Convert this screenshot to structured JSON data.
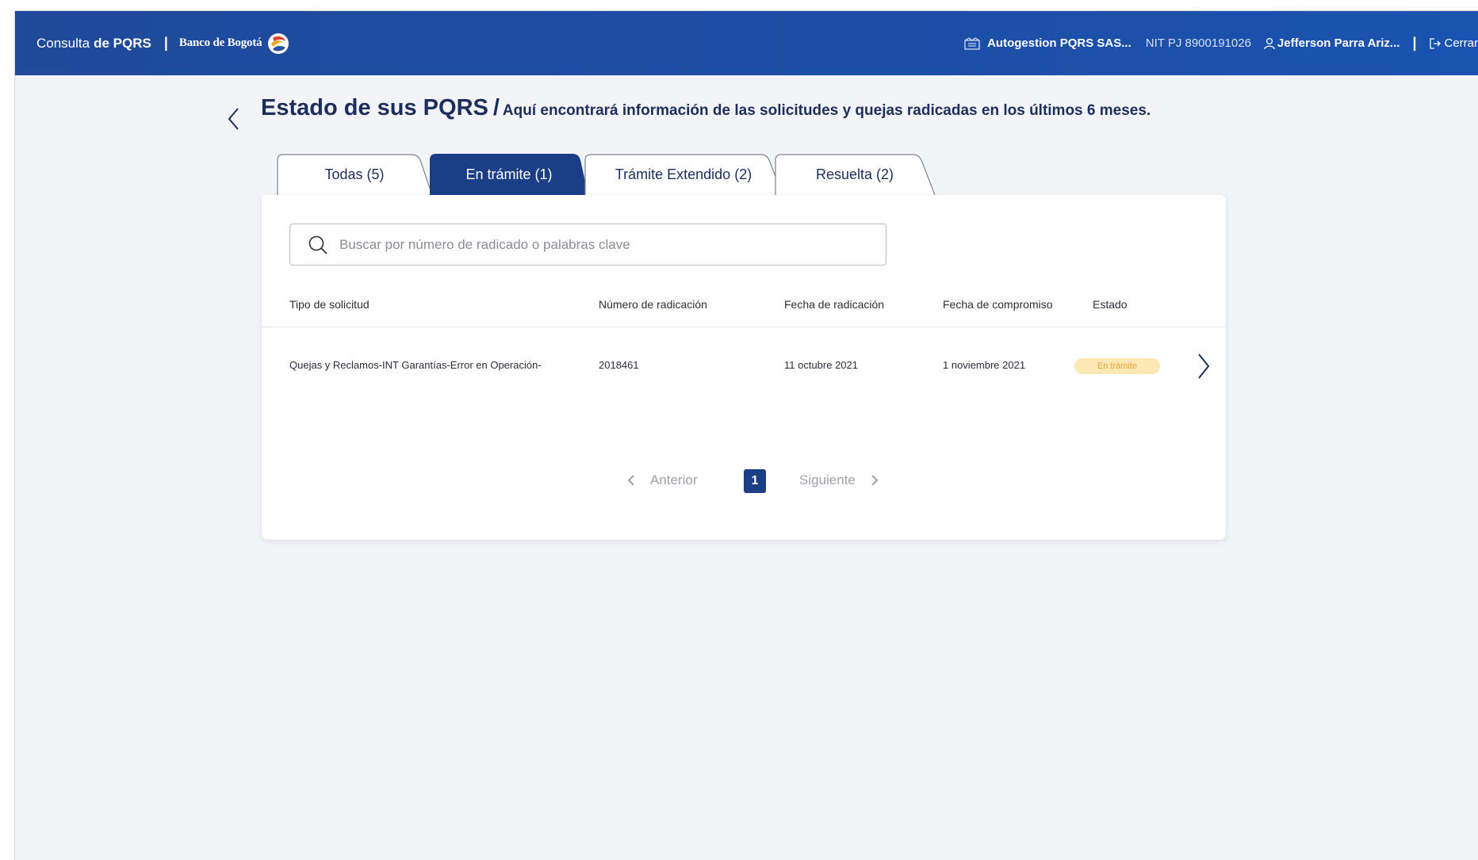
{
  "header": {
    "brand_prefix": "Consulta",
    "brand_bold": "de PQRS",
    "separator": "|",
    "bank_name": "Banco de Bogotá",
    "company": "Autogestion PQRS SAS...",
    "nit": "NIT PJ 8900191026",
    "user": "Jefferson Parra Ariz...",
    "logout": "Cerrar"
  },
  "page": {
    "title": "Estado de sus PQRS",
    "slash": "/",
    "subtitle": "Aquí encontrará información de las solicitudes y quejas radicadas en los últimos 6 meses."
  },
  "tabs": [
    {
      "label": "Todas (5)",
      "active": false
    },
    {
      "label": "En trámite (1)",
      "active": true
    },
    {
      "label": "Trámite Extendido (2)",
      "active": false
    },
    {
      "label": "Resuelta (2)",
      "active": false
    }
  ],
  "search": {
    "placeholder": "Buscar por número de radicado o palabras clave",
    "value": ""
  },
  "table": {
    "columns": [
      "Tipo de solicitud",
      "Número de radicación",
      "Fecha de radicación",
      "Fecha de compromiso",
      "Estado"
    ],
    "rows": [
      {
        "tipo": "Quejas y Reclamos-INT Garantías-Error en Operación-",
        "numero": "2018461",
        "fecha_radicacion": "11 octubre 2021",
        "fecha_compromiso": "1 noviembre 2021",
        "estado": "En trámite"
      }
    ]
  },
  "pagination": {
    "prev": "Anterior",
    "current": "1",
    "next": "Siguiente"
  },
  "colors": {
    "header_blue": "#1f4a9a",
    "active_tab": "#1b3f87",
    "badge_bg": "#fde7b3",
    "badge_text": "#e8a43a"
  }
}
